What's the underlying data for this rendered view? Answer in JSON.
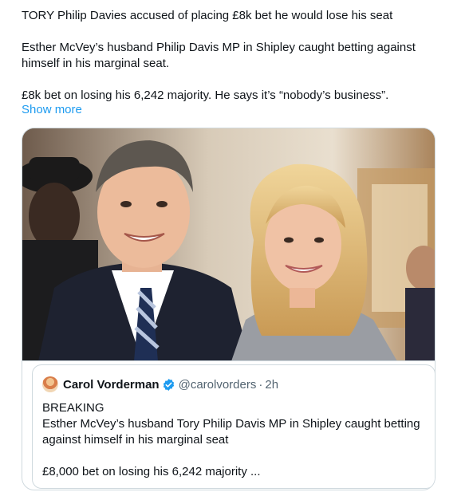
{
  "tweet": {
    "line1": "TORY Philip Davies accused of placing £8k bet he would lose his seat",
    "line2": "Esther McVey’s husband Philip Davis MP in Shipley caught betting against himself in his marginal seat.",
    "line3": "£8k bet on losing his 6,242 majority. He says it’s “nobody’s business”.",
    "show_more": "Show more"
  },
  "quoted": {
    "name": "Carol Vorderman",
    "handle": "@carolvorders",
    "separator": "·",
    "time": "2h",
    "line1": "BREAKING",
    "line2": "Esther McVey’s husband Tory Philip Davis MP in Shipley caught betting against himself in his marginal seat",
    "line3": "£8,000 bet on losing his 6,242 majority ..."
  },
  "colors": {
    "link": "#1d9bf0",
    "verified": "#1d9bf0",
    "border": "#cfd9de",
    "muted": "#536471"
  }
}
